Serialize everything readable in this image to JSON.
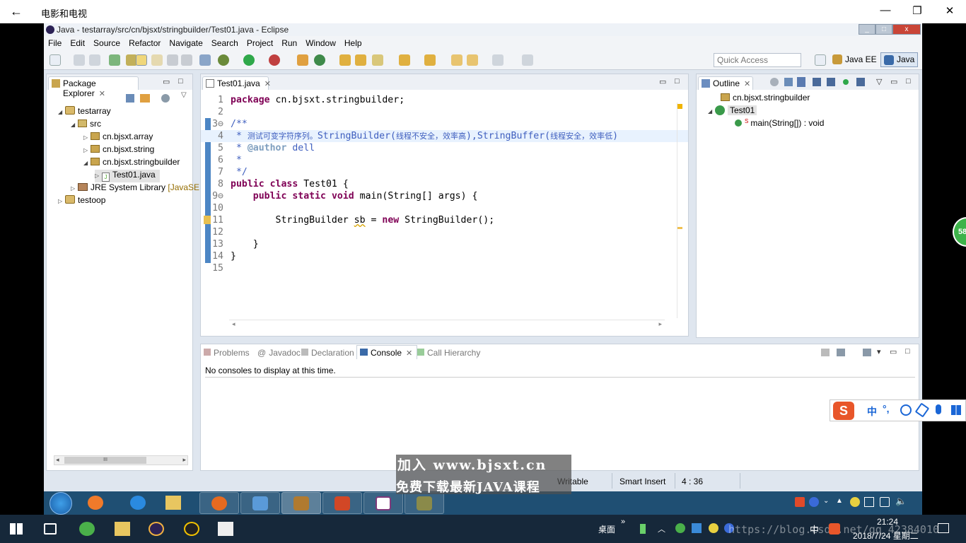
{
  "outer_app": {
    "back_glyph": "←",
    "title": "电影和电视",
    "minimize_glyph": "—",
    "restore_glyph": "❐",
    "close_glyph": "✕"
  },
  "eclipse": {
    "window_title": "Java - testarray/src/cn/bjsxt/stringbuilder/Test01.java - Eclipse",
    "menu": [
      "File",
      "Edit",
      "Source",
      "Refactor",
      "Navigate",
      "Search",
      "Project",
      "Run",
      "Window",
      "Help"
    ],
    "quick_access_placeholder": "Quick Access",
    "perspectives": {
      "java_ee": "Java EE",
      "java": "Java"
    },
    "package_explorer": {
      "tab_label": "Package Explorer",
      "tree": [
        {
          "label": "testarray",
          "expanded": true
        },
        {
          "label": "src",
          "expanded": true
        },
        {
          "label": "cn.bjsxt.array",
          "expanded": false
        },
        {
          "label": "cn.bjsxt.string",
          "expanded": false
        },
        {
          "label": "cn.bjsxt.stringbuilder",
          "expanded": true
        },
        {
          "label": "Test01.java",
          "expanded": false
        },
        {
          "label": "JRE System Library",
          "suffix": "[JavaSE",
          "expanded": false
        },
        {
          "label": "testoop",
          "expanded": false
        }
      ],
      "scroll_thumb_glyph": "III"
    },
    "editor": {
      "tab_label": "Test01.java",
      "lines": [
        {
          "n": "1",
          "text": "package cn.bjsxt.stringbuilder;"
        },
        {
          "n": "2",
          "text": ""
        },
        {
          "n": "3⊖",
          "text": "/**"
        },
        {
          "n": "4",
          "text": " * 测试可变字符序列。StringBuilder(线程不安全，效率高),StringBuffer(线程安全，效率低)"
        },
        {
          "n": "5",
          "text": " * @author dell"
        },
        {
          "n": "6",
          "text": " *"
        },
        {
          "n": "7",
          "text": " */"
        },
        {
          "n": "8",
          "text": "public class Test01 {"
        },
        {
          "n": "9⊖",
          "text": "    public static void main(String[] args) {"
        },
        {
          "n": "10",
          "text": ""
        },
        {
          "n": "11",
          "text": "        StringBuilder sb = new StringBuilder();"
        },
        {
          "n": "12",
          "text": ""
        },
        {
          "n": "13",
          "text": "    }"
        },
        {
          "n": "14",
          "text": "}"
        },
        {
          "n": "15",
          "text": ""
        }
      ]
    },
    "outline": {
      "tab_label": "Outline",
      "items": [
        {
          "label": "cn.bjsxt.stringbuilder"
        },
        {
          "label": "Test01"
        },
        {
          "label": "main(String[]) : void"
        }
      ]
    },
    "bottom_panel": {
      "tabs": [
        "Problems",
        "Javadoc",
        "Declaration",
        "Console",
        "Call Hierarchy"
      ],
      "active_tab": "Console",
      "console_message": "No consoles to display at this time."
    },
    "status_bar": {
      "writable": "Writable",
      "insert_mode": "Smart Insert",
      "position": "4 : 36"
    }
  },
  "watermark": {
    "line1": "加入 www.bjsxt.cn",
    "line2": "免费下载最新JAVA课程"
  },
  "win7_taskbar": {
    "apps": [
      "start",
      "windows-live",
      "internet-explorer",
      "file-explorer",
      "firefox",
      "remote-desktop",
      "java-ee",
      "powerpoint",
      "onenote",
      "dictionary"
    ]
  },
  "ime_bar": {
    "logo": "S",
    "lang": "中",
    "punct": "°,"
  },
  "side_badge": "58",
  "win10_taskbar": {
    "desktop_label": "桌面",
    "chevron": "»",
    "ime_lang": "中",
    "time": "21:24",
    "date": "2018/7/24 星期二",
    "blog_watermark": "https://blog.csdn.net/qq_42384010"
  }
}
